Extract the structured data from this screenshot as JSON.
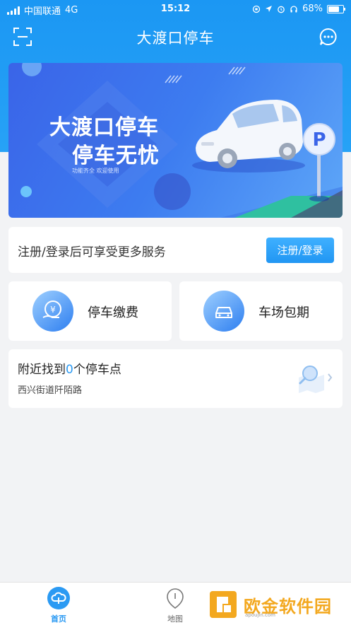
{
  "status_bar": {
    "carrier": "中国联通",
    "network": "4G",
    "time": "15:12",
    "battery": "68%"
  },
  "nav": {
    "title": "大渡口停车"
  },
  "banner": {
    "title_line1": "大渡口停车",
    "title_line2": "停车无忧",
    "subtitle": "功能齐全 欢迎使用"
  },
  "login_card": {
    "prompt": "注册/登录后可享受更多服务",
    "button": "注册/登录"
  },
  "services": [
    {
      "label": "停车缴费",
      "icon": "yen-payment-icon"
    },
    {
      "label": "车场包期",
      "icon": "car-icon"
    }
  ],
  "nearby": {
    "prefix": "附近找到",
    "count": "0",
    "suffix": "个停车点",
    "address": "西兴街道阡陌路"
  },
  "tab_bar": {
    "home": "首页",
    "map": "地图"
  },
  "watermark": {
    "text": "欧金软件园",
    "url": "apoujin.com"
  },
  "colors": {
    "primary": "#2b9af3",
    "header_bg": "#1b97f3",
    "banner_bg": "#3a64e8",
    "watermark": "#f3a81f"
  }
}
